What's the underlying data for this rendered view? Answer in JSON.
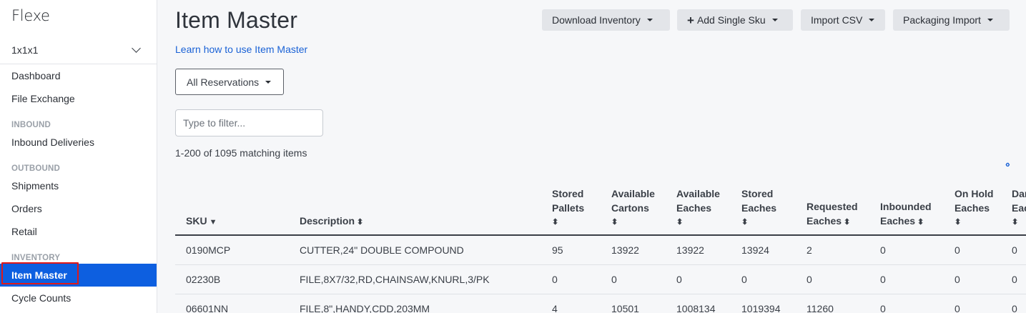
{
  "sidebar": {
    "logo": "Flexe",
    "account": "1x1x1",
    "items": [
      {
        "label": "Dashboard"
      },
      {
        "label": "File Exchange"
      }
    ],
    "sections": {
      "inbound": {
        "title": "INBOUND",
        "items": [
          "Inbound Deliveries"
        ]
      },
      "outbound": {
        "title": "OUTBOUND",
        "items": [
          "Shipments",
          "Orders",
          "Retail"
        ]
      },
      "inventory": {
        "title": "INVENTORY",
        "items": [
          "Item Master",
          "Cycle Counts"
        ]
      }
    },
    "active_item": "Item Master",
    "colors": {
      "active_bg": "#0d5fe0",
      "highlight_outline": "#e01919"
    }
  },
  "header": {
    "title": "Item Master",
    "learn_link": "Learn how to use Item Master",
    "buttons": {
      "download": "Download Inventory",
      "add_sku": "Add Single Sku",
      "import_csv": "Import CSV",
      "packaging": "Packaging Import"
    }
  },
  "controls": {
    "reservations": "All Reservations",
    "filter_placeholder": "Type to filter...",
    "count_text": "1-200 of 1095 matching items",
    "scroll_icon": "code-arrows-icon"
  },
  "table": {
    "columns": [
      {
        "label": "SKU",
        "sort": "desc"
      },
      {
        "label": "Description",
        "sort": "both"
      },
      {
        "label": "Stored Pallets",
        "sort": "both"
      },
      {
        "label": "Available Cartons",
        "sort": "both"
      },
      {
        "label": "Available Eaches",
        "sort": "both"
      },
      {
        "label": "Stored Eaches",
        "sort": "both"
      },
      {
        "label": "Requested Eaches",
        "sort": "both"
      },
      {
        "label": "Inbounded Eaches",
        "sort": "both"
      },
      {
        "label": "On Hold Eaches",
        "sort": "both"
      },
      {
        "label": "Damaged Eaches",
        "sort": "both"
      }
    ],
    "rows": [
      [
        "0190MCP",
        "CUTTER,24\" DOUBLE COMPOUND",
        "95",
        "13922",
        "13922",
        "13924",
        "2",
        "0",
        "0",
        "0"
      ],
      [
        "02230B",
        "FILE,8X7/32,RD,CHAINSAW,KNURL,3/PK",
        "0",
        "0",
        "0",
        "0",
        "0",
        "0",
        "0",
        "0"
      ],
      [
        "06601NN",
        "FILE,8\",HANDY,CDD,203MM",
        "4",
        "10501",
        "1008134",
        "1019394",
        "11260",
        "0",
        "0",
        "0"
      ]
    ]
  }
}
